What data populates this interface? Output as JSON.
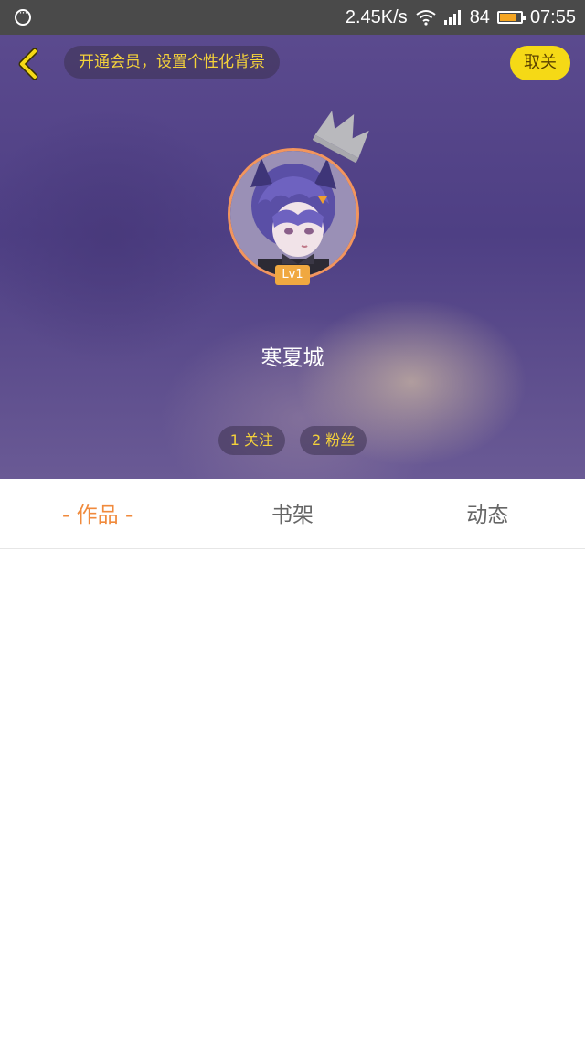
{
  "status_bar": {
    "notification_icon": "message-dots-icon",
    "network_speed": "2.45K/s",
    "battery_level": "84",
    "battery_fraction": 0.84,
    "battery_color": "#f5a623",
    "time": "07:55"
  },
  "header": {
    "back_icon": "chevron-left-icon",
    "vip_banner": "开通会员，设置个性化背景",
    "unfollow_label": "取关",
    "crown_icon": "crown-icon",
    "level": "Lv1",
    "username": "寒夏城",
    "following": "1 关注",
    "followers": "2 粉丝"
  },
  "tabs": [
    {
      "label": "- 作品 -",
      "active": true
    },
    {
      "label": "书架",
      "active": false
    },
    {
      "label": "动态",
      "active": false
    }
  ],
  "colors": {
    "accent": "#f08a3c",
    "yellow": "#f5d916",
    "header_purple": "#4e3f84"
  }
}
